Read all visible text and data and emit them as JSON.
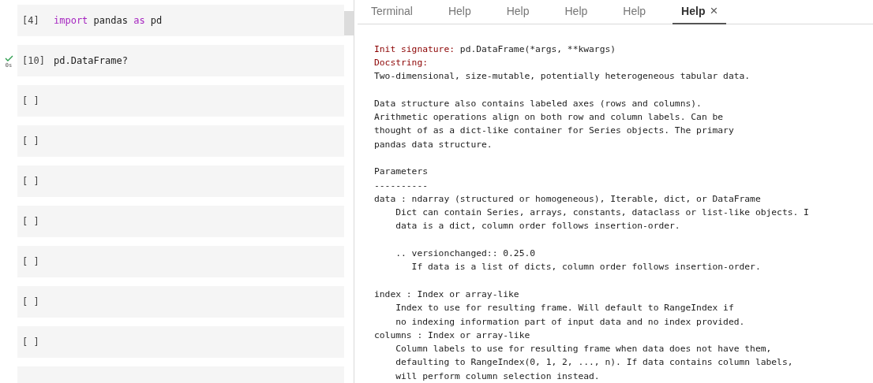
{
  "notebook": {
    "cells": [
      {
        "prompt": "[4]",
        "executed": false,
        "code": [
          {
            "text": "import",
            "kind": "keyword"
          },
          {
            "text": " pandas ",
            "kind": "plain"
          },
          {
            "text": "as",
            "kind": "keyword"
          },
          {
            "text": " pd",
            "kind": "plain"
          }
        ]
      },
      {
        "prompt": "[10]",
        "executed": true,
        "time": "0s",
        "code": [
          {
            "text": "pd.DataFrame?",
            "kind": "plain"
          }
        ]
      },
      {
        "prompt": "[ ]",
        "executed": false
      },
      {
        "prompt": "[ ]",
        "executed": false
      },
      {
        "prompt": "[ ]",
        "executed": false
      },
      {
        "prompt": "[ ]",
        "executed": false
      },
      {
        "prompt": "[ ]",
        "executed": false
      },
      {
        "prompt": "[ ]",
        "executed": false
      },
      {
        "prompt": "[ ]",
        "executed": false
      },
      {
        "executed": false
      }
    ]
  },
  "tabs": [
    {
      "label": "Terminal",
      "selected": false
    },
    {
      "label": "Help",
      "selected": false
    },
    {
      "label": "Help",
      "selected": false
    },
    {
      "label": "Help",
      "selected": false
    },
    {
      "label": "Help",
      "selected": false
    },
    {
      "label": "Help",
      "selected": true,
      "close": "×"
    }
  ],
  "help": {
    "blocks": [
      [
        [
          {
            "text": "Init signature:",
            "kind": "heading"
          },
          {
            "text": " pd.DataFrame(*args, **kwargs)",
            "kind": "plain"
          }
        ],
        [
          {
            "text": "Docstring:",
            "kind": "heading"
          }
        ],
        [
          {
            "text": "Two-dimensional, size-mutable, potentially heterogeneous tabular data.",
            "kind": "plain"
          }
        ]
      ],
      [
        [
          {
            "text": "Data structure also contains labeled axes (rows and columns).",
            "kind": "plain"
          }
        ],
        [
          {
            "text": "Arithmetic operations align on both row and column labels. Can be",
            "kind": "plain"
          }
        ],
        [
          {
            "text": "thought of as a dict-like container for Series objects. The primary",
            "kind": "plain"
          }
        ],
        [
          {
            "text": "pandas data structure.",
            "kind": "plain"
          }
        ]
      ],
      [
        [
          {
            "text": "Parameters",
            "kind": "plain"
          }
        ],
        [
          {
            "text": "----------",
            "kind": "plain"
          }
        ],
        [
          {
            "text": "data : ndarray (structured or homogeneous), Iterable, dict, or DataFrame",
            "kind": "plain"
          }
        ],
        [
          {
            "text": "    Dict can contain Series, arrays, constants, dataclass or list-like objects. I",
            "kind": "plain"
          }
        ],
        [
          {
            "text": "    data is a dict, column order follows insertion-order.",
            "kind": "plain"
          }
        ]
      ],
      [
        [
          {
            "text": "    .. versionchanged:: 0.25.0",
            "kind": "plain"
          }
        ],
        [
          {
            "text": "       If data is a list of dicts, column order follows insertion-order.",
            "kind": "plain"
          }
        ]
      ],
      [
        [
          {
            "text": "index : Index or array-like",
            "kind": "plain"
          }
        ],
        [
          {
            "text": "    Index to use for resulting frame. Will default to RangeIndex if",
            "kind": "plain"
          }
        ],
        [
          {
            "text": "    no indexing information part of input data and no index provided.",
            "kind": "plain"
          }
        ],
        [
          {
            "text": "columns : Index or array-like",
            "kind": "plain"
          }
        ],
        [
          {
            "text": "    Column labels to use for resulting frame when data does not have them,",
            "kind": "plain"
          }
        ],
        [
          {
            "text": "    defaulting to RangeIndex(0, 1, 2, ..., n). If data contains column labels,",
            "kind": "plain"
          }
        ],
        [
          {
            "text": "    will perform column selection instead.",
            "kind": "plain"
          }
        ]
      ]
    ]
  }
}
